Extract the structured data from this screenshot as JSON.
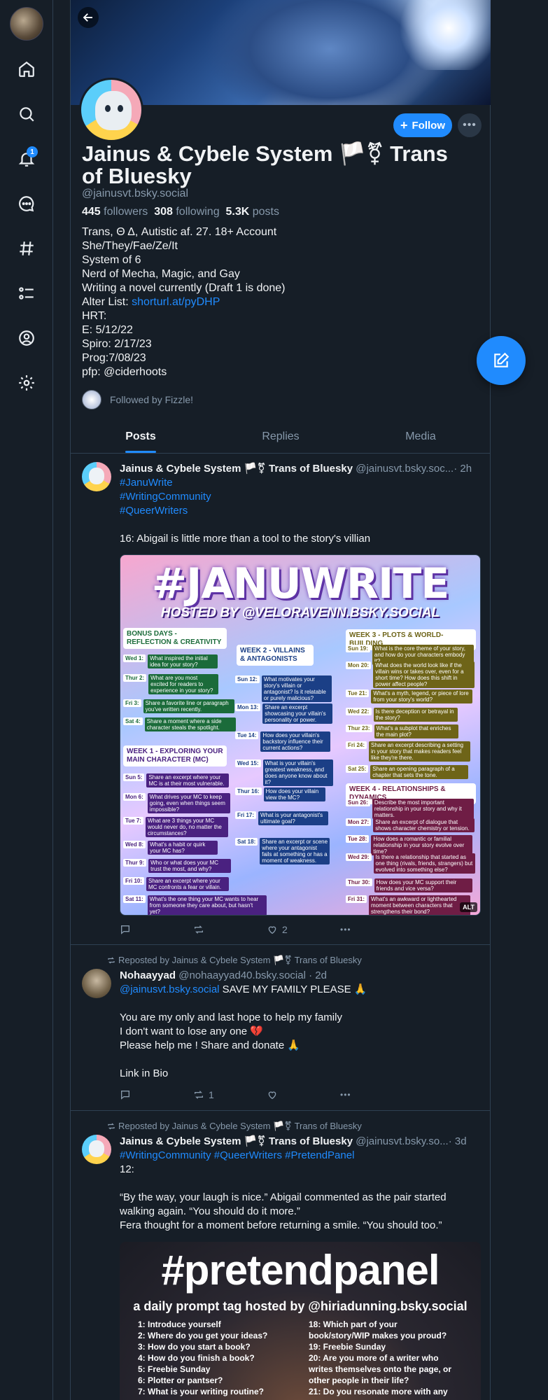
{
  "nav": {
    "notification_count": "1",
    "icons": [
      "home-icon",
      "search-icon",
      "bell-icon",
      "chat-icon",
      "hashtag-icon",
      "list-icon",
      "profile-icon",
      "settings-icon"
    ]
  },
  "profile": {
    "display_name": "Jainus & Cybele System 🏳️⚧ Trans of Bluesky",
    "handle": "@jainusvt.bsky.social",
    "followers_count": "445",
    "followers_label": "followers",
    "following_count": "308",
    "following_label": "following",
    "posts_count": "5.3K",
    "posts_label": "posts",
    "follow_label": "Follow",
    "bio": [
      "Trans, Θ Δ, Autistic af. 27. 18+ Account",
      "She/They/Fae/Ze/It",
      "System of 6",
      "Nerd of Mecha, Magic, and Gay",
      "Writing a novel currently (Draft 1 is done)"
    ],
    "alter_list_label": "Alter List: ",
    "alter_list_link": "shorturl.at/pyDHP",
    "bio_tail": [
      "HRT:",
      "E: 5/12/22",
      "Spiro: 2/17/23",
      "Prog:7/08/23",
      "pfp: @ciderhoots"
    ],
    "followed_by": "Followed by Fizzle!"
  },
  "tabs": [
    "Posts",
    "Replies",
    "Media"
  ],
  "posts": [
    {
      "author": "Jainus & Cybele System 🏳️⚧ Trans of Bluesky",
      "handle": "@jainusvt.bsky.soc...",
      "time": "· 2h",
      "tags": [
        "#JanuWrite",
        "#WritingCommunity",
        "#QueerWriters"
      ],
      "text": "16: Abigail is little more than a tool to the story's villian",
      "likes": "2"
    },
    {
      "repost_label": "Reposted by Jainus & Cybele System 🏳️⚧ Trans of Bluesky",
      "author": "Nohaayyad",
      "handle": "@nohaayyad40.bsky.social",
      "time": "· 2d",
      "mention": "@jainusvt.bsky.social",
      "line1": " SAVE MY FAMILY PLEASE 🙏",
      "lines": [
        "You are my only and last hope to help my family",
        "I don't want to lose any one 💔",
        "Please help me ! Share and donate 🙏"
      ],
      "footer": "Link in Bio",
      "reposts": "1"
    },
    {
      "repost_label": "Reposted by Jainus & Cybele System 🏳️⚧ Trans of Bluesky",
      "author": "Jainus & Cybele System 🏳️⚧ Trans of Bluesky",
      "handle": "@jainusvt.bsky.so...",
      "time": "· 3d",
      "tags": "#WritingCommunity #QueerWriters #PretendPanel",
      "num": "12:",
      "lines": [
        "“By the way, your laugh is nice.” Abigail commented as the pair started",
        "walking again. “You should do it more.”",
        "Fera thought for a moment before returning a smile. “You should too.”"
      ]
    }
  ],
  "janu_image": {
    "title": "#JANUWRITE",
    "subtitle": "HOSTED BY @VELORAVENN.BSKY.SOCIAL",
    "bonus_header": "BONUS DAYS - REFLECTION & CREATIVITY",
    "week1_header": "WEEK 1 - EXPLORING YOUR MAIN CHARACTER (MC)",
    "week2_header": "WEEK 2 - VILLAINS & ANTAGONISTS",
    "week3_header": "WEEK 3 - PLOTS & WORLD-BUILDING",
    "week4_header": "WEEK 4 - RELATIONSHIPS & DYNAMICS",
    "bonus": [
      {
        "d": "Wed 1:",
        "t": "What inspired the initial idea for your story?"
      },
      {
        "d": "Thur 2:",
        "t": "What are you most excited for readers to experience in your story?"
      },
      {
        "d": "Fri 3:",
        "t": "Share a favorite line or paragraph you've written recently."
      },
      {
        "d": "Sat 4:",
        "t": "Share a moment where a side character steals the spotlight."
      }
    ],
    "week1": [
      {
        "d": "Sun 5:",
        "t": "Share an excerpt where your MC is at their most vulnerable."
      },
      {
        "d": "Mon 6:",
        "t": "What drives your MC to keep going, even when things seem impossible?"
      },
      {
        "d": "Tue 7:",
        "t": "What are 3 things your MC would never do, no matter the circumstances?"
      },
      {
        "d": "Wed 8:",
        "t": "What's a habit or quirk your MC has?"
      },
      {
        "d": "Thur 9:",
        "t": "Who or what does your MC trust the most, and why?"
      },
      {
        "d": "Fri 10:",
        "t": "Share an excerpt where your MC confronts a fear or villain."
      },
      {
        "d": "Sat 11:",
        "t": "What's the one thing your MC wants to hear from someone they care about, but hasn't yet?"
      }
    ],
    "week2": [
      {
        "d": "Sun 12:",
        "t": "What motivates your story's villain or antagonist? Is it relatable or purely malicious?"
      },
      {
        "d": "Mon 13:",
        "t": "Share an excerpt showcasing your villain's personality or power."
      },
      {
        "d": "Tue 14:",
        "t": "How does your villain's backstory influence their current actions?"
      },
      {
        "d": "Wed 15:",
        "t": "What is your villain's greatest weakness, and does anyone know about it?"
      },
      {
        "d": "Thur 16:",
        "t": "How does your villain view the MC?"
      },
      {
        "d": "Fri 17:",
        "t": "What is your antagonist's ultimate goal?"
      },
      {
        "d": "Sat 18:",
        "t": "Share an excerpt or scene where your antagonist fails at something or has a moment of weakness."
      }
    ],
    "week3": [
      {
        "d": "Sun 19:",
        "t": "What is the core theme of your story, and how do your characters embody it?"
      },
      {
        "d": "Mon 20:",
        "t": "What does the world look like if the villain wins or takes over, even for a short time? How does this shift in power affect people?"
      },
      {
        "d": "Tue 21:",
        "t": "What's a myth, legend, or piece of lore from your story's world?"
      },
      {
        "d": "Wed 22:",
        "t": "Is there deception or betrayal in the story?"
      },
      {
        "d": "Thur 23:",
        "t": "What's a subplot that enriches the main plot?"
      },
      {
        "d": "Fri 24:",
        "t": "Share an excerpt describing a setting in your story that makes readers feel like they're there."
      },
      {
        "d": "Sat 25:",
        "t": "Share an opening paragraph of a chapter that sets the tone."
      }
    ],
    "week4": [
      {
        "d": "Sun 26:",
        "t": "Describe the most important relationship in your story and why it matters."
      },
      {
        "d": "Mon 27:",
        "t": "Share an excerpt of dialogue that shows character chemistry or tension."
      },
      {
        "d": "Tue 28:",
        "t": "How does a romantic or familial relationship in your story evolve over time?"
      },
      {
        "d": "Wed 29:",
        "t": "Is there a relationship that started as one thing (rivals, friends, strangers) but evolved into something else?"
      },
      {
        "d": "Thur 30:",
        "t": "How does your MC support their friends and vice versa?"
      },
      {
        "d": "Fri 31:",
        "t": "What's an awkward or lighthearted moment between characters that strengthens their bond?"
      }
    ],
    "alt": "ALT"
  },
  "pp_image": {
    "title": "#pretendpanel",
    "subtitle": "a daily prompt tag hosted by @hiriadunning.bsky.social",
    "left": [
      "1: Introduce yourself",
      "2: Where do you get your ideas?",
      "3: How do you start a book?",
      "4: How do you finish a book?",
      "5: Freebie Sunday",
      "6: Plotter or pantser?",
      "7: What is your writing routine?"
    ],
    "right": [
      "18: Which part of your",
      "book/story/WIP makes you proud?",
      "19: Freebie Sunday",
      "20: Are you more of a writer who",
      "writes themselves onto the page, or",
      "other people in their life?",
      "21: Do you resonate more with any"
    ]
  },
  "colors": {
    "accent": "#208bfe",
    "background": "#161e27",
    "muted": "#8799ab"
  }
}
